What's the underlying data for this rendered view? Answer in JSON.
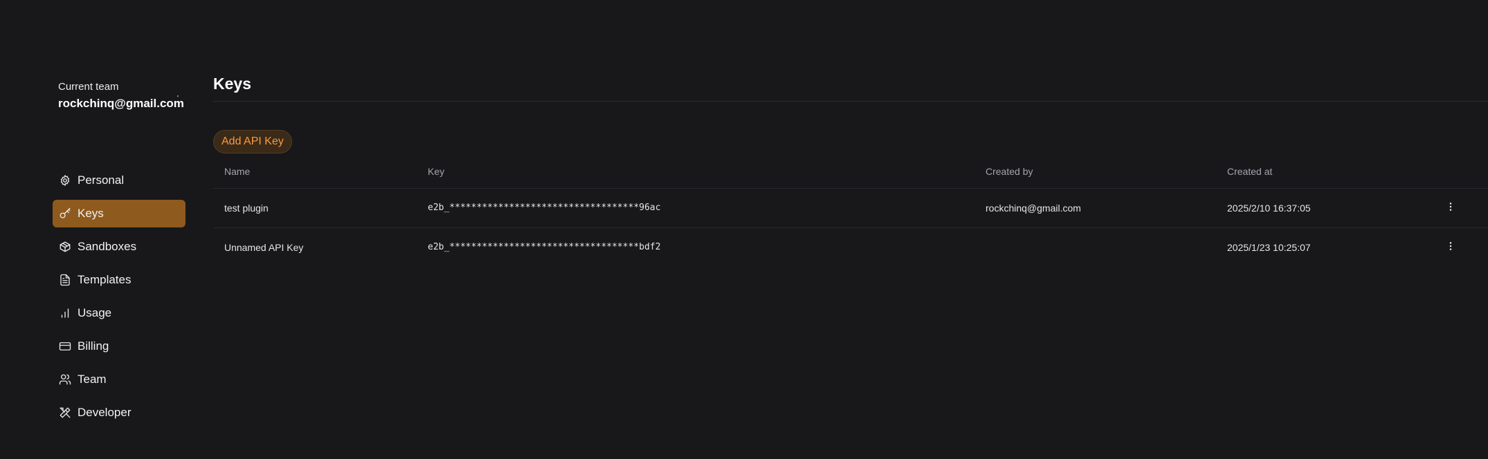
{
  "team": {
    "label": "Current team",
    "name": "rockchinq@gmail.com"
  },
  "nav": [
    {
      "label": "Personal",
      "icon": "gear-icon",
      "active": false
    },
    {
      "label": "Keys",
      "icon": "key-icon",
      "active": true
    },
    {
      "label": "Sandboxes",
      "icon": "box-icon",
      "active": false
    },
    {
      "label": "Templates",
      "icon": "file-text-icon",
      "active": false
    },
    {
      "label": "Usage",
      "icon": "bar-chart-icon",
      "active": false
    },
    {
      "label": "Billing",
      "icon": "credit-card-icon",
      "active": false
    },
    {
      "label": "Team",
      "icon": "users-icon",
      "active": false
    },
    {
      "label": "Developer",
      "icon": "tools-icon",
      "active": false
    }
  ],
  "page": {
    "title": "Keys",
    "add_button": "Add API Key"
  },
  "table": {
    "headers": {
      "name": "Name",
      "key": "Key",
      "created_by": "Created by",
      "created_at": "Created at"
    },
    "rows": [
      {
        "name": "test plugin",
        "key": "e2b_***********************************96ac",
        "created_by": "rockchinq@gmail.com",
        "created_at": "2025/2/10 16:37:05"
      },
      {
        "name": "Unnamed API Key",
        "key": "e2b_***********************************bdf2",
        "created_by": "",
        "created_at": "2025/1/23 10:25:07"
      }
    ]
  },
  "colors": {
    "background": "#18181b",
    "active_nav": "#8f5a1d",
    "accent_text": "#ff9a3d"
  }
}
